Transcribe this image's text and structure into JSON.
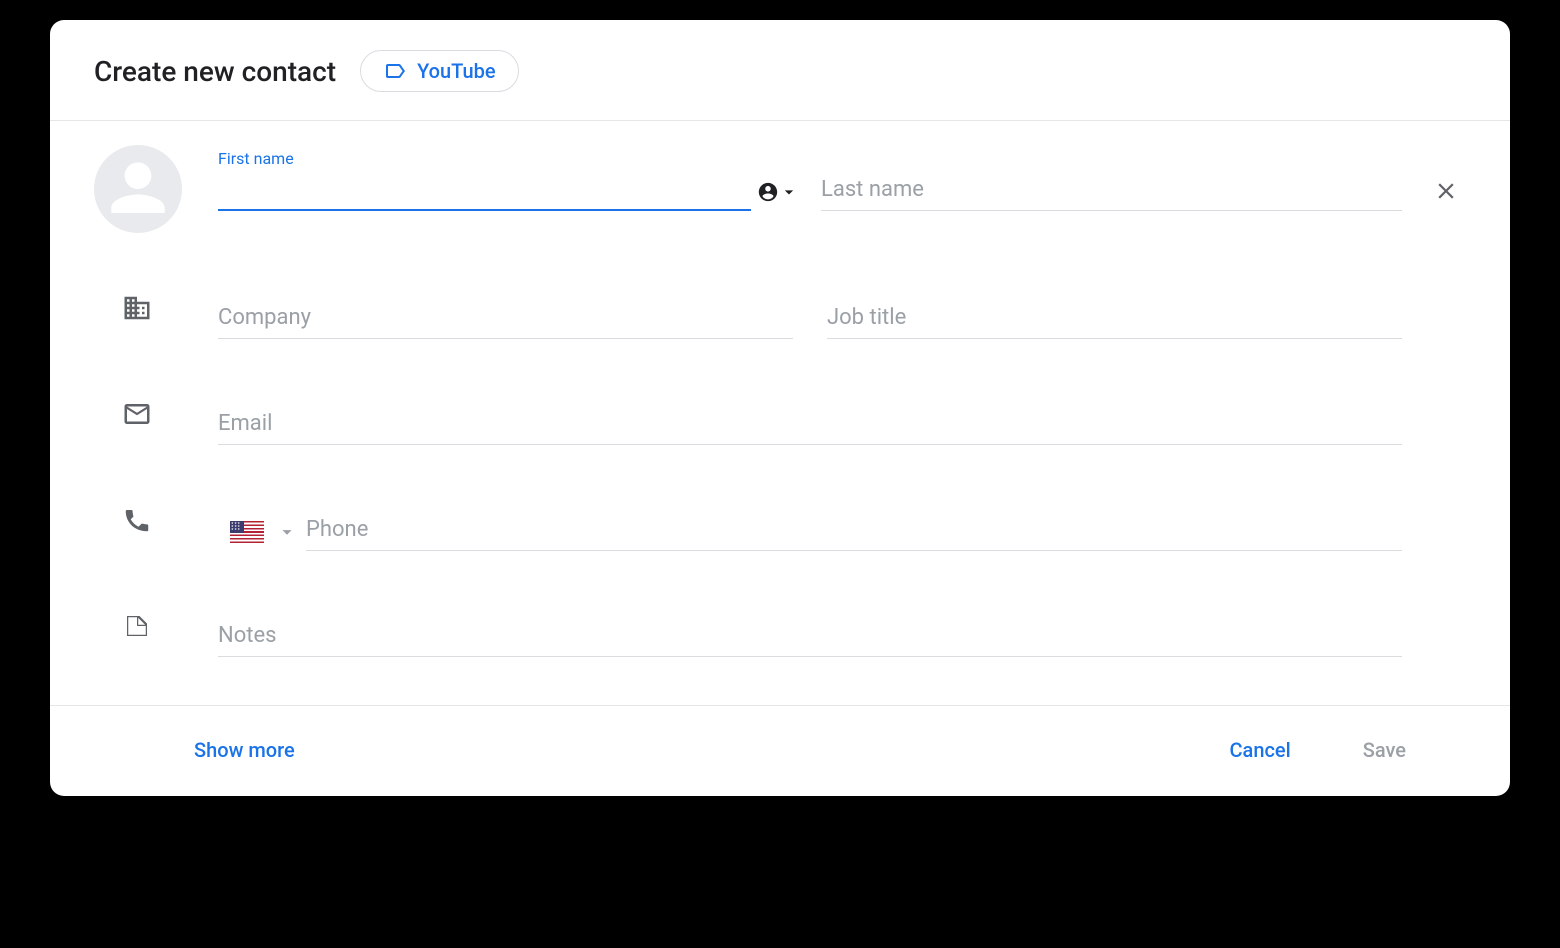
{
  "header": {
    "title": "Create new contact",
    "chip_label": "YouTube"
  },
  "fields": {
    "first_name": {
      "label": "First name",
      "placeholder": ""
    },
    "last_name": {
      "placeholder": "Last name"
    },
    "company": {
      "placeholder": "Company"
    },
    "job_title": {
      "placeholder": "Job title"
    },
    "email": {
      "placeholder": "Email"
    },
    "phone": {
      "placeholder": "Phone",
      "country": "US"
    },
    "notes": {
      "placeholder": "Notes"
    }
  },
  "footer": {
    "show_more": "Show more",
    "cancel": "Cancel",
    "save": "Save"
  },
  "colors": {
    "accent": "#1a73e8",
    "placeholder": "#9aa0a6",
    "icon_gray": "#5f6368"
  }
}
